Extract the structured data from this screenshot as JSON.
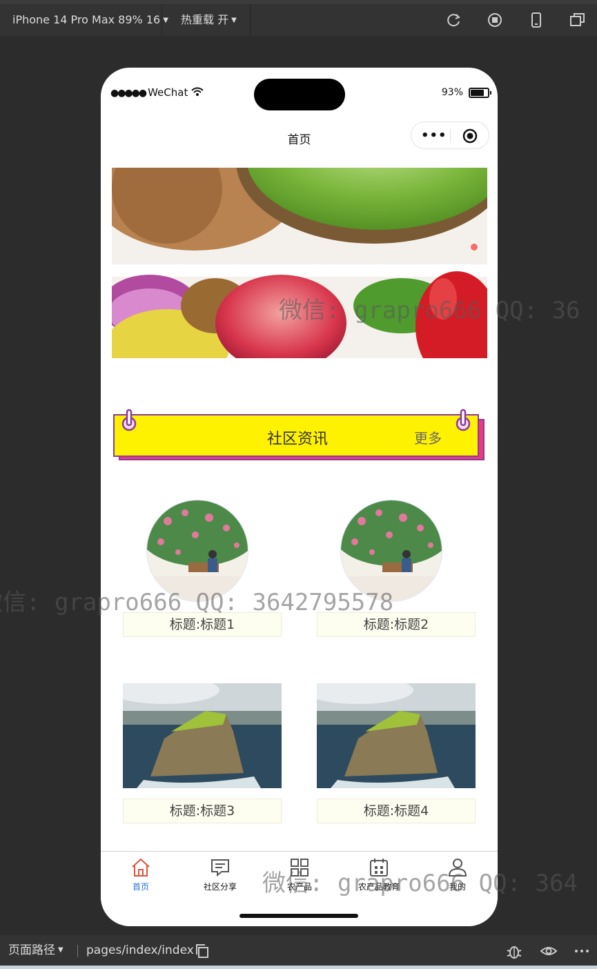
{
  "toolbar": {
    "device": "iPhone 14 Pro Max 89% 16",
    "hot_reload": "热重载 开",
    "icons": [
      "refresh-icon",
      "record-icon",
      "phone-icon",
      "window-icon"
    ]
  },
  "status_bar": {
    "carrier": "WeChat",
    "battery": "93%",
    "battery_level": 0.93
  },
  "nav": {
    "title": "首页",
    "capsule_dots": "•••"
  },
  "swiper": {
    "active_dot_color": "#f46c6c"
  },
  "section": {
    "title": "社区资讯",
    "more": "更多",
    "bg_color": "#fff200",
    "border_color": "#8a3a9c",
    "shadow_color": "#e83d7a"
  },
  "cards": [
    {
      "title": "标题:标题1",
      "image": "garden-illustration"
    },
    {
      "title": "标题:标题2",
      "image": "garden-illustration"
    },
    {
      "title": "标题:标题3",
      "image": "sea-cliff-photo"
    },
    {
      "title": "标题:标题4",
      "image": "sea-cliff-photo"
    }
  ],
  "tabbar": {
    "items": [
      {
        "label": "首页",
        "icon": "home-icon",
        "active": true
      },
      {
        "label": "社区分享",
        "icon": "chat-icon",
        "active": false
      },
      {
        "label": "农产品",
        "icon": "grid-icon",
        "active": false
      },
      {
        "label": "农产品教育",
        "icon": "calendar-icon",
        "active": false
      },
      {
        "label": "我的",
        "icon": "user-icon",
        "active": false
      }
    ],
    "active_color": "#2b6fd6"
  },
  "bottom_bar": {
    "label": "页面路径",
    "path": "pages/index/index"
  },
  "watermarks": [
    "微信: grapro666 QQ: 36",
    "微信: grapro666 QQ: 3642795578",
    "微信: grapro666 QQ: 364"
  ]
}
